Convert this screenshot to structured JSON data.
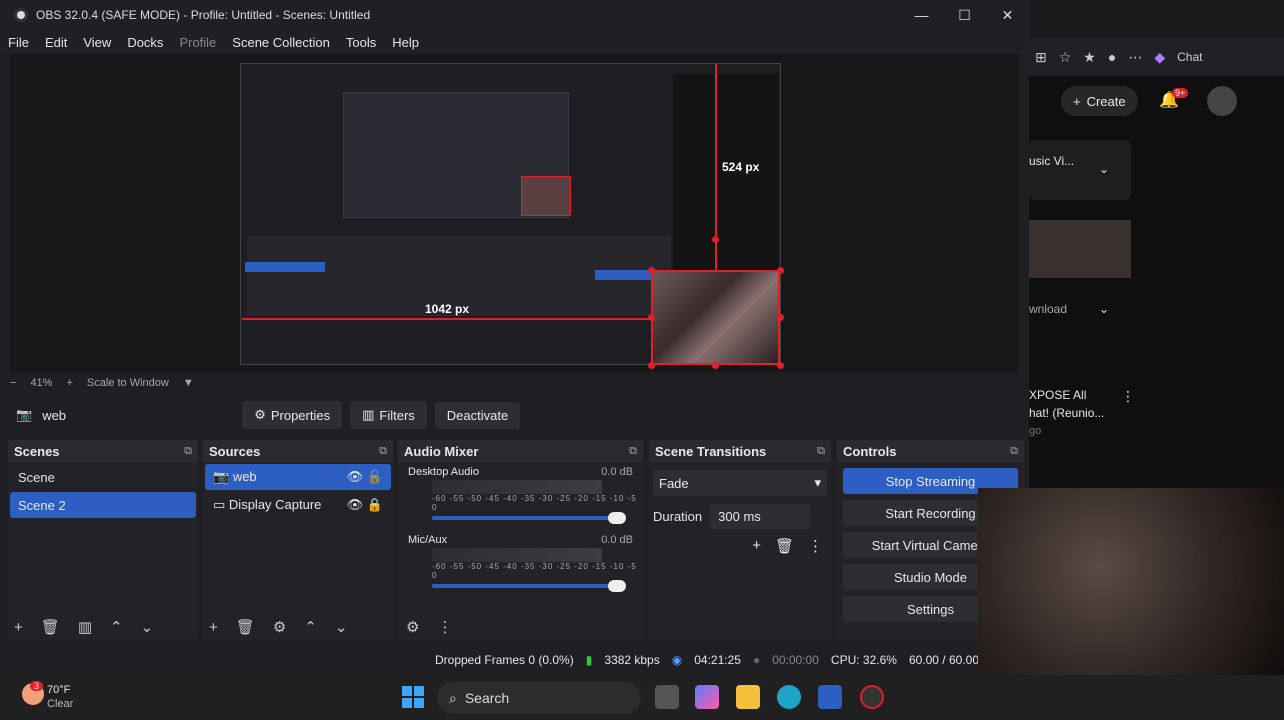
{
  "window": {
    "title": "OBS 32.0.4 (SAFE MODE) - Profile: Untitled - Scenes: Untitled",
    "controls": [
      "—",
      "☐",
      "✕"
    ]
  },
  "menu": {
    "file": "File",
    "edit": "Edit",
    "view": "View",
    "docks": "Docks",
    "profile": "Profile",
    "scene_collection": "Scene Collection",
    "tools": "Tools",
    "help": "Help"
  },
  "preview": {
    "height_label": "524 px",
    "width_label": "1042 px"
  },
  "zoom": {
    "minus": "−",
    "value": "41%",
    "plus": "+",
    "mode": "Scale to Window"
  },
  "source_toolbar": {
    "source_name": "web",
    "properties": "Properties",
    "filters": "Filters",
    "deactivate": "Deactivate"
  },
  "scenes": {
    "title": "Scenes",
    "items": [
      "Scene",
      "Scene 2"
    ],
    "selected_index": 1
  },
  "sources": {
    "title": "Sources",
    "items": [
      {
        "name": "web",
        "icon": "camera-icon"
      },
      {
        "name": "Display Capture",
        "icon": "monitor-icon"
      }
    ]
  },
  "audio_mixer": {
    "title": "Audio Mixer",
    "channels": [
      {
        "name": "Desktop Audio",
        "db": "0.0 dB",
        "ticks": "-60 -55 -50 -45 -40 -35 -30 -25 -20 -15 -10 -5 0"
      },
      {
        "name": "Mic/Aux",
        "db": "0.0 dB",
        "ticks": "-60 -55 -50 -45 -40 -35 -30 -25 -20 -15 -10 -5 0"
      }
    ]
  },
  "transitions": {
    "title": "Scene Transitions",
    "selected": "Fade",
    "duration_label": "Duration",
    "duration_value": "300 ms"
  },
  "controls": {
    "title": "Controls",
    "stop_streaming": "Stop Streaming",
    "start_recording": "Start Recording",
    "start_virtual_camera": "Start Virtual Camera",
    "studio_mode": "Studio Mode",
    "settings": "Settings"
  },
  "status": {
    "dropped_frames": "Dropped Frames 0 (0.0%)",
    "bitrate": "3382 kbps",
    "stream_time": "04:21:25",
    "record_time": "00:00:00",
    "cpu": "CPU: 32.6%",
    "fps": "60.00 / 60.00"
  },
  "browser": {
    "create": "Create",
    "notifications": "9+",
    "chat": "Chat",
    "item1": "usic Vi...",
    "item2": "wnload",
    "item3_line1": "XPOSE All",
    "item3_line2": "hat! (Reunio...",
    "item3_sub": "go"
  },
  "taskbar": {
    "temp": "70°F",
    "weather": "Clear",
    "weather_badge": "3",
    "search_placeholder": "Search"
  },
  "colors": {
    "accent": "#2d5ec2",
    "guide_red": "#e0202a",
    "panel_bg": "#222227"
  }
}
